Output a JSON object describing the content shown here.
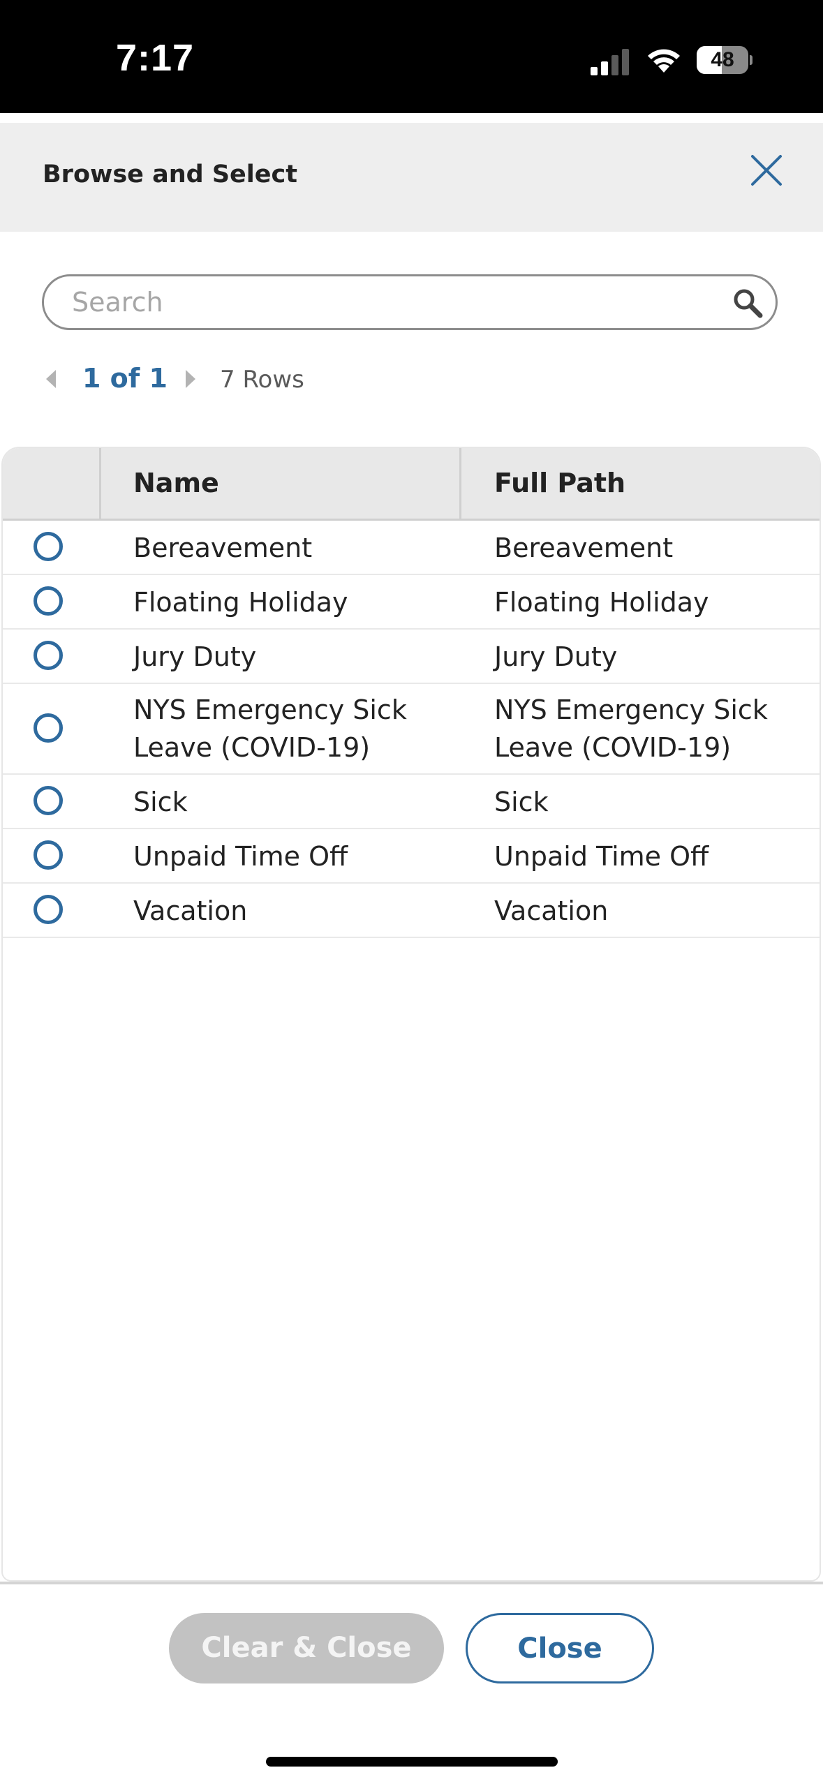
{
  "status_bar": {
    "time": "7:17",
    "battery_level": "48",
    "battery_fraction": 0.48,
    "signal_bars_active": 2,
    "signal_bars_total": 4
  },
  "header": {
    "title": "Browse and Select",
    "close_icon": "close-x-icon"
  },
  "search": {
    "placeholder": "Search",
    "value": "",
    "icon": "search-icon"
  },
  "pagination": {
    "current": "1 of 1",
    "rows": "7 Rows"
  },
  "table": {
    "columns": [
      "Name",
      "Full Path"
    ],
    "rows": [
      {
        "name": "Bereavement",
        "full_path": "Bereavement",
        "selected": false
      },
      {
        "name": "Floating Holiday",
        "full_path": "Floating Holiday",
        "selected": false
      },
      {
        "name": "Jury Duty",
        "full_path": "Jury Duty",
        "selected": false
      },
      {
        "name": "NYS Emergency Sick\nLeave (COVID-19)",
        "full_path": "NYS Emergency Sick\nLeave (COVID-19)",
        "selected": false
      },
      {
        "name": "Sick",
        "full_path": "Sick",
        "selected": false
      },
      {
        "name": "Unpaid Time Off",
        "full_path": "Unpaid Time Off",
        "selected": false
      },
      {
        "name": "Vacation",
        "full_path": "Vacation",
        "selected": false
      }
    ]
  },
  "footer": {
    "clear_close_label": "Clear & Close",
    "close_label": "Close"
  },
  "colors": {
    "accent": "#2e6a9e",
    "header_bg": "#eeeeee",
    "table_header_bg": "#e8e8e8",
    "disabled_button": "#c2c2c2"
  }
}
